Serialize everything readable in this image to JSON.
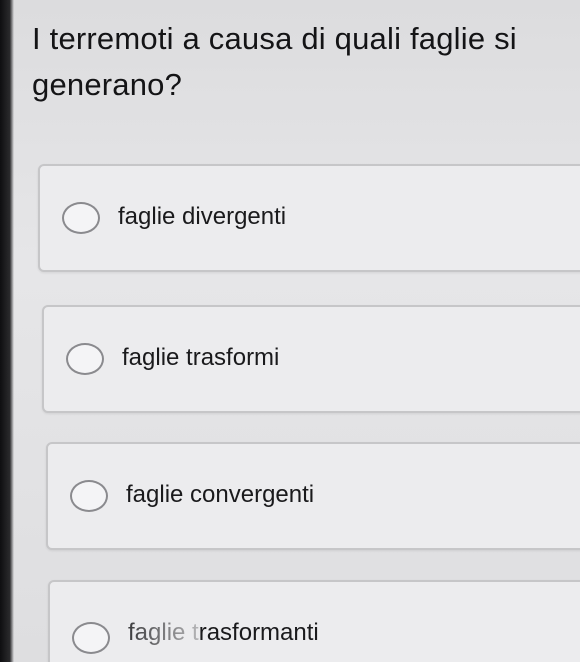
{
  "quiz": {
    "question": "I terremoti a causa di quali faglie si generano?",
    "options": [
      {
        "label": "faglie divergenti",
        "selected": false
      },
      {
        "label": "faglie trasformi",
        "selected": false
      },
      {
        "label": "faglie convergenti",
        "selected": false
      },
      {
        "label": "faglie trasformanti",
        "selected": false
      }
    ]
  }
}
